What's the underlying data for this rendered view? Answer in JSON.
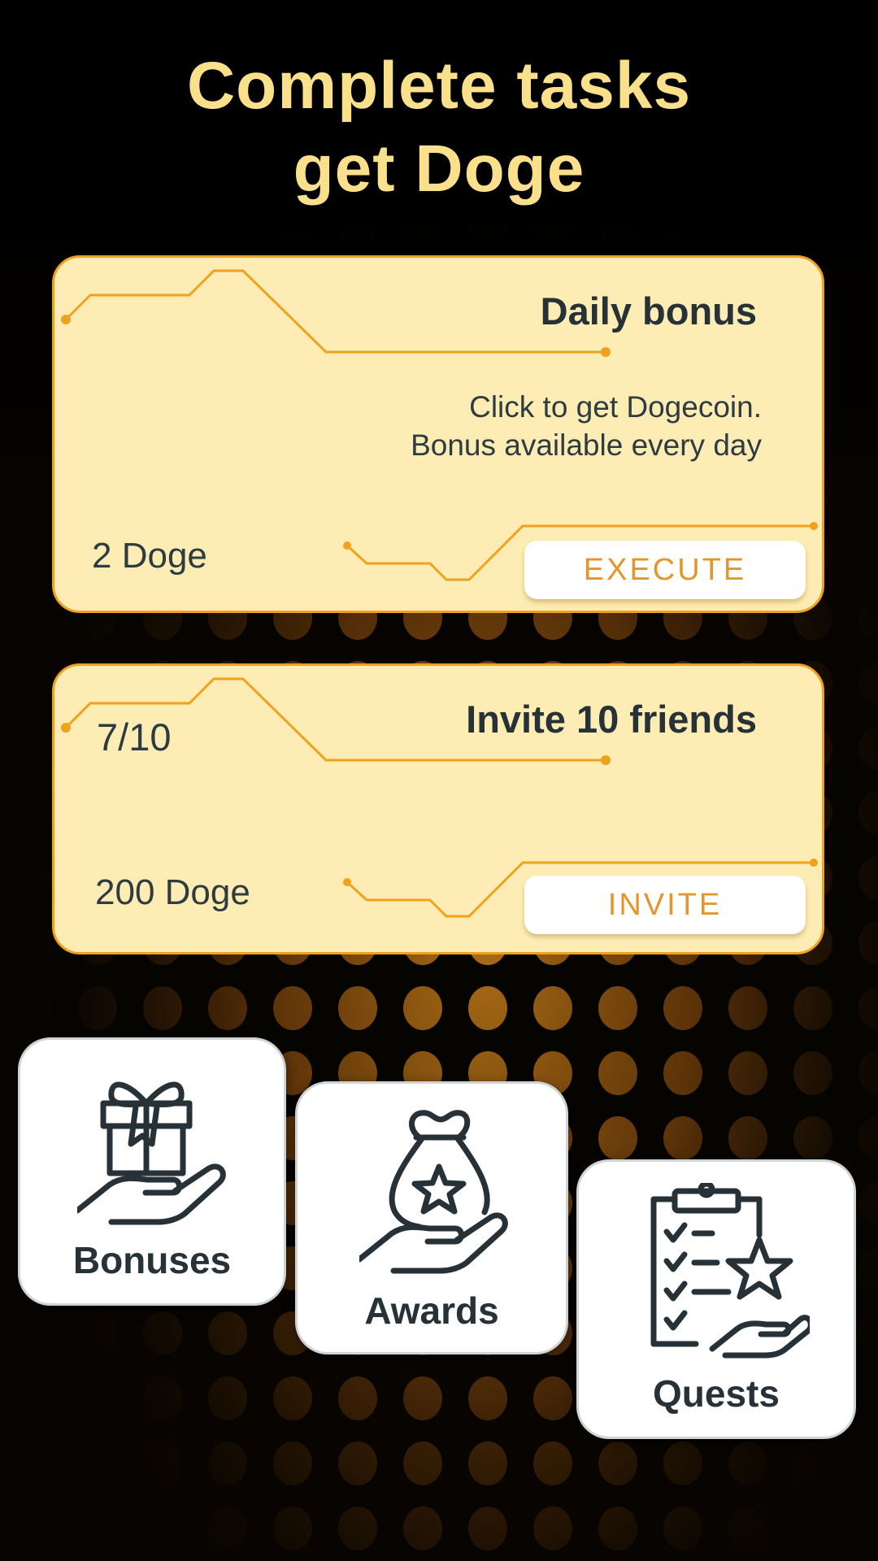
{
  "header": {
    "title_line1": "Complete tasks",
    "title_line2": "get Doge"
  },
  "tasks": [
    {
      "title": "Daily bonus",
      "description_line1": "Click to get Dogecoin.",
      "description_line2": "Bonus available every day",
      "reward": "2 Doge",
      "button_label": "EXECUTE"
    },
    {
      "title": "Invite 10 friends",
      "progress": "7/10",
      "reward": "200 Doge",
      "button_label": "INVITE"
    }
  ],
  "tiles": [
    {
      "label": "Bonuses",
      "icon": "gift-in-hand-icon"
    },
    {
      "label": "Awards",
      "icon": "money-bag-in-hand-icon"
    },
    {
      "label": "Quests",
      "icon": "checklist-star-hand-icon"
    }
  ],
  "colors": {
    "accent_yellow": "#fbe08c",
    "card_background": "#fdedb4",
    "card_border": "#f0a11d",
    "button_text": "#e5962a",
    "dark_text": "#263238",
    "dot_orange": "#f29a1c"
  }
}
